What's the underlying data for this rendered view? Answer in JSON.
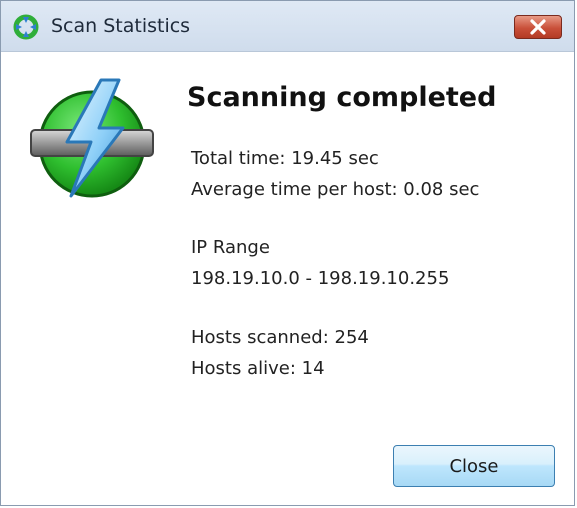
{
  "window": {
    "title": "Scan Statistics"
  },
  "content": {
    "heading": "Scanning completed",
    "total_time": "Total time: 19.45 sec",
    "avg_time": "Average time per host: 0.08 sec",
    "ip_range_label": "IP Range",
    "ip_range_value": "198.19.10.0 - 198.19.10.255",
    "hosts_scanned": "Hosts scanned: 254",
    "hosts_alive": "Hosts alive: 14"
  },
  "buttons": {
    "close_label": "Close"
  },
  "colors": {
    "titlebar": "#dfe9f5",
    "close_red": "#c9503a",
    "logo_green": "#3cc43c",
    "logo_blue": "#4aa8e8"
  },
  "icons": {
    "app": "ipscan-app-icon",
    "close": "close-icon",
    "logo": "lightning-logo-icon"
  }
}
